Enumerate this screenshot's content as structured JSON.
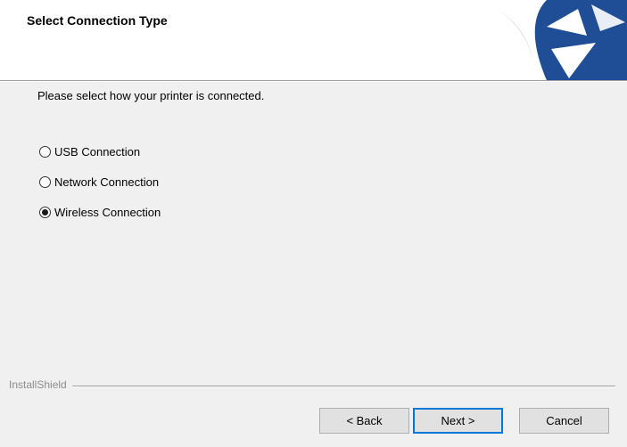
{
  "header": {
    "title": "Select Connection Type",
    "logo_icon": "installshield-logo-icon",
    "logo_colors": {
      "blue": "#1f4e96",
      "white": "#ffffff"
    }
  },
  "main": {
    "prompt": "Please select how your printer is connected.",
    "options": [
      {
        "label": "USB Connection",
        "selected": false
      },
      {
        "label": "Network Connection",
        "selected": false
      },
      {
        "label": "Wireless Connection",
        "selected": true
      }
    ]
  },
  "footer": {
    "brand": "InstallShield",
    "buttons": {
      "back": "< Back",
      "next": "Next >",
      "cancel": "Cancel"
    },
    "default_button_color": "#0078d7"
  }
}
